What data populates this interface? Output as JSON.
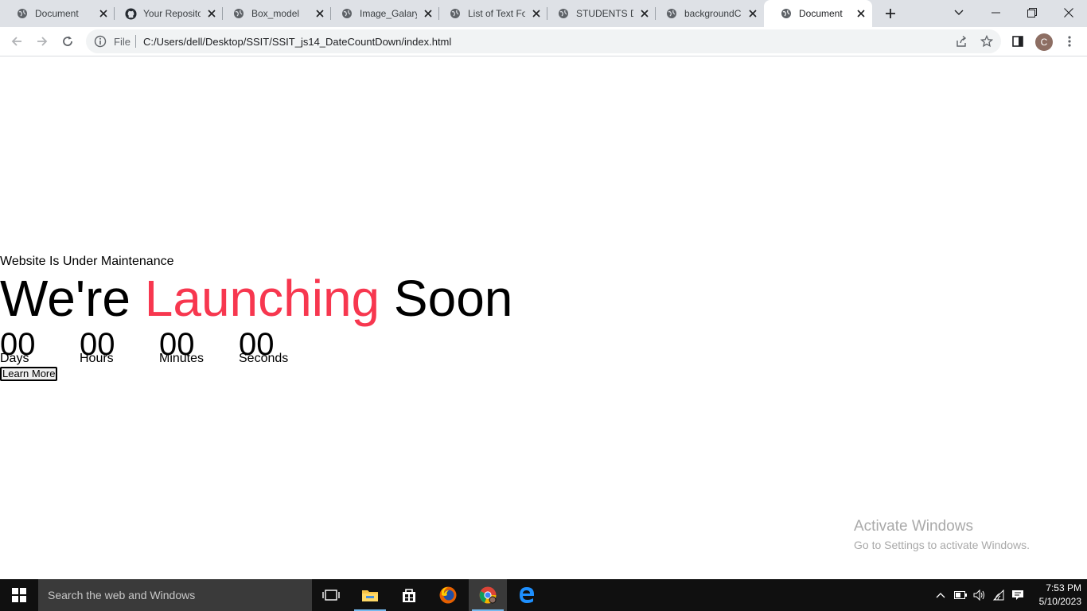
{
  "browser": {
    "tabs": [
      {
        "title": "Document",
        "favicon": "globe-icon"
      },
      {
        "title": "Your Reposito",
        "favicon": "github-icon"
      },
      {
        "title": "Box_model",
        "favicon": "globe-icon"
      },
      {
        "title": "Image_Galary",
        "favicon": "globe-icon"
      },
      {
        "title": "List of Text Fo",
        "favicon": "globe-icon"
      },
      {
        "title": "STUDENTS DE",
        "favicon": "globe-icon"
      },
      {
        "title": "backgroundC",
        "favicon": "globe-icon"
      },
      {
        "title": "Document",
        "favicon": "globe-icon",
        "active": true
      }
    ],
    "address": {
      "scheme_label": "File",
      "url": "C:/Users/dell/Desktop/SSIT/SSIT_js14_DateCountDown/index.html"
    },
    "profile_initial": "C"
  },
  "page": {
    "subtitle": "Website Is Under Maintenance",
    "heading": {
      "before": "We're",
      "accent": "Launching",
      "after": "Soon"
    },
    "accent_color": "#f7374f",
    "countdown": [
      {
        "value": "00",
        "label": "Days"
      },
      {
        "value": "00",
        "label": "Hours"
      },
      {
        "value": "00",
        "label": "Minutes"
      },
      {
        "value": "00",
        "label": "Seconds"
      }
    ],
    "learn_more": "Learn More"
  },
  "watermark": {
    "line1": "Activate Windows",
    "line2": "Go to Settings to activate Windows."
  },
  "taskbar": {
    "search_placeholder": "Search the web and Windows",
    "time": "7:53 PM",
    "date": "5/10/2023"
  }
}
